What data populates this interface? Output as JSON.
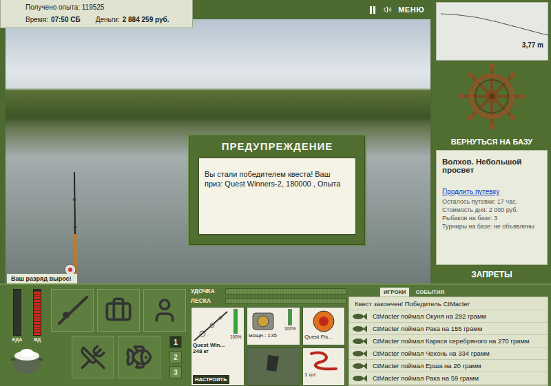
{
  "hud": {
    "experience": "Получено опыта: 119525",
    "time_label": "Время:",
    "time": "07:50 СБ",
    "money_label": "Деньги:",
    "money": "2 884 259 руб."
  },
  "top_controls": {
    "menu": "МЕНЮ"
  },
  "depth_chart": {
    "values": [
      1.05,
      1.1,
      1.2,
      1.35,
      1.5,
      1.75,
      2.0,
      2.3,
      2.6,
      2.9,
      3.2,
      3.5,
      3.77
    ],
    "reading": "3,77 m"
  },
  "base": {
    "return_button": "ВЕРНУТЬСЯ НА БАЗУ",
    "location": "Волхов. Небольшой просвет",
    "extend_link": "Продлить путевку",
    "details": [
      "Осталось путевки: 17 час.",
      "Стоимость дня: 2 000 руб.",
      "Рыбаков на базе: 3",
      "Турниры на базе: не объявлены"
    ],
    "bans_button": "ЗАПРЕТЫ"
  },
  "dialog": {
    "title": "ПРЕДУПРЕЖДЕНИЕ",
    "message": "Вы стали победителем квеста! Ваш приз: Quest Winners-2, 180000 , Опыта"
  },
  "notification": "Ваш разряд вырос!",
  "meters": [
    {
      "label": "ЕДА",
      "level": 0,
      "color": "#4caf50"
    },
    {
      "label": "ВД",
      "level": 0.95,
      "color": "#d3281a"
    }
  ],
  "slots": [
    {
      "label": "1",
      "selected": true
    },
    {
      "label": "2",
      "selected": false
    },
    {
      "label": "3",
      "selected": false
    }
  ],
  "tension_bars": [
    {
      "label": "УДОЧКА",
      "level": 0
    },
    {
      "label": "ЛЕСКА",
      "level": 0
    }
  ],
  "tackle": {
    "rod": {
      "name": "Quest Win...",
      "load": "248 кг",
      "wear": "100%",
      "wear_level": 1
    },
    "reel": {
      "power": "мощн.: 135",
      "wear": "100%",
      "wear_level": 1
    },
    "lure": {
      "name": "Quest Fis..."
    },
    "bait": {
      "count": "1 шт"
    },
    "setup_button": "НАСТРОИТЬ"
  },
  "log": {
    "tabs": [
      {
        "label": "ИГРОКИ",
        "selected": true
      },
      {
        "label": "СОБЫТИЯ",
        "selected": false
      }
    ],
    "message": "Квест закончен! Победитель CtMacter",
    "entries": [
      "CtMacter поймал Окуня на 292 грамм",
      "CtMacter поймал Рака на 155 грамм",
      "CtMacter поймал Карася серебряного на 270 грамм",
      "CtMacter поймал Чехонь на 334 грамм",
      "CtMacter поймал Ерша на 20 грамм",
      "CtMacter поймал Рака на 59 грамм"
    ]
  }
}
